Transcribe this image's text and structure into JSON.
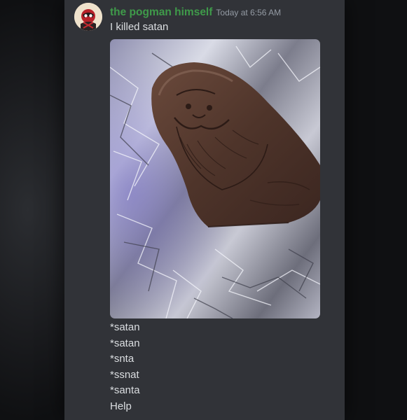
{
  "message": {
    "author": "the pogman himself",
    "timestamp": "Today at 6:56 AM",
    "lines": [
      "I killed satan",
      "*satan",
      "*satan",
      "*snta",
      "*ssnat",
      "*santa",
      "Help"
    ]
  },
  "colors": {
    "panel_background": "#313338",
    "username": "#3f9a4a",
    "text": "#dbdee1",
    "timestamp": "#949ba4"
  }
}
